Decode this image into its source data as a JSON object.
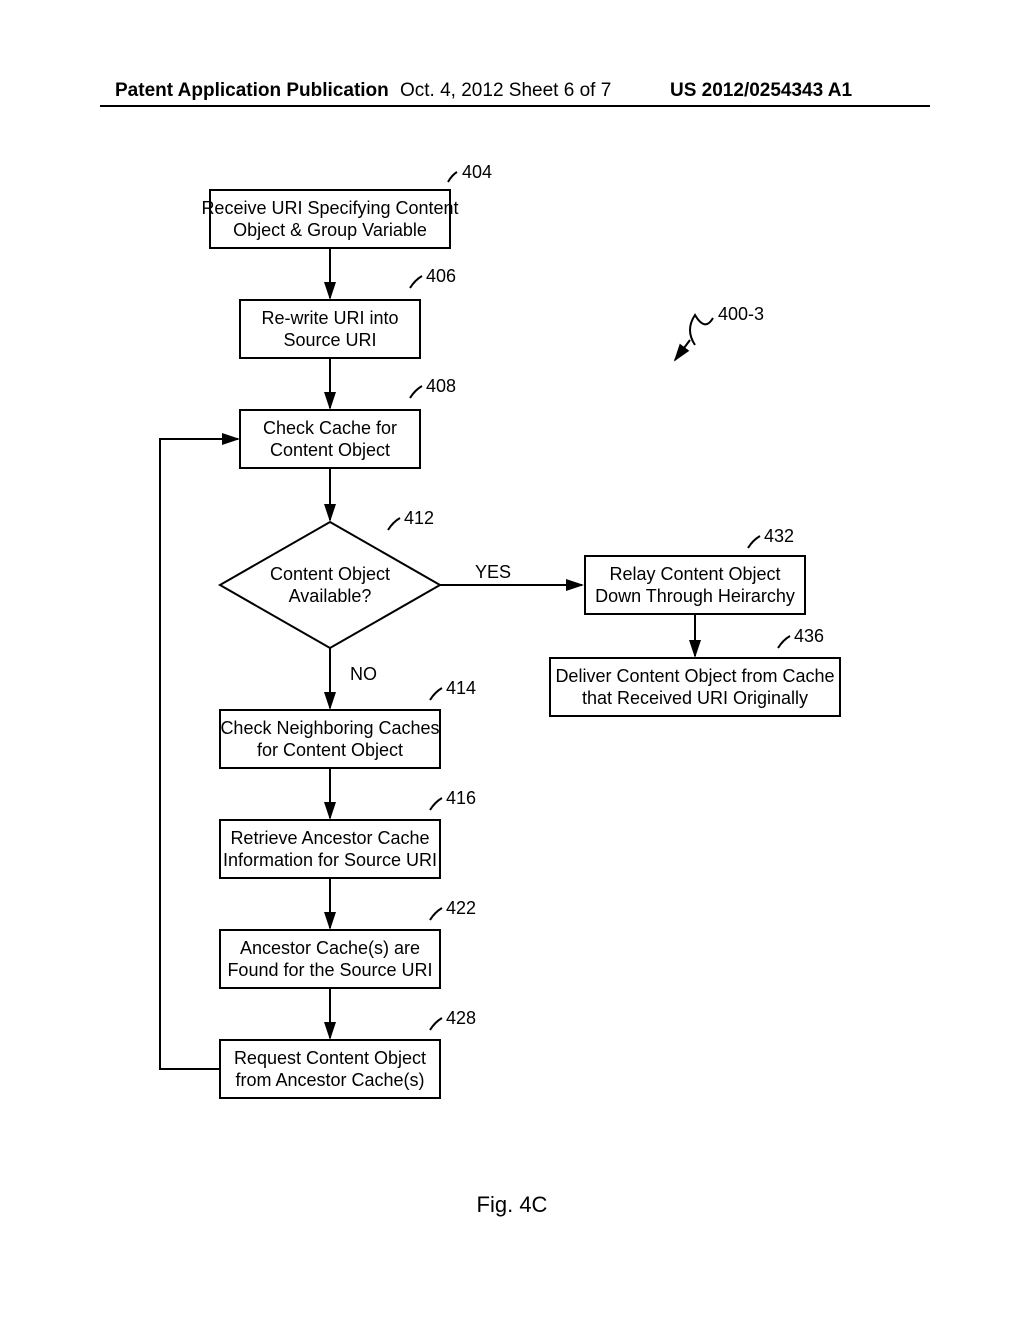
{
  "header": {
    "left": "Patent Application Publication",
    "center": "Oct. 4, 2012  Sheet 6 of 7",
    "right": "US 2012/0254343 A1"
  },
  "figure": {
    "caption": "Fig. 4C",
    "ref_main": "400-3",
    "nodes": {
      "n404": {
        "ref": "404",
        "line1": "Receive URI Specifying Content",
        "line2": "Object & Group Variable"
      },
      "n406": {
        "ref": "406",
        "line1": "Re-write URI into",
        "line2": "Source URI"
      },
      "n408": {
        "ref": "408",
        "line1": "Check Cache for",
        "line2": "Content Object"
      },
      "n412": {
        "ref": "412",
        "line1": "Content Object",
        "line2": "Available?",
        "yes": "YES",
        "no": "NO"
      },
      "n414": {
        "ref": "414",
        "line1": "Check Neighboring Caches",
        "line2": "for Content Object"
      },
      "n416": {
        "ref": "416",
        "line1": "Retrieve Ancestor Cache",
        "line2": "Information for Source URI"
      },
      "n422": {
        "ref": "422",
        "line1": "Ancestor Cache(s) are",
        "line2": "Found for the Source URI"
      },
      "n428": {
        "ref": "428",
        "line1": "Request Content Object",
        "line2": "from Ancestor Cache(s)"
      },
      "n432": {
        "ref": "432",
        "line1": "Relay Content Object",
        "line2": "Down Through Heirarchy"
      },
      "n436": {
        "ref": "436",
        "line1": "Deliver Content Object from Cache",
        "line2": "that Received URI Originally"
      }
    }
  }
}
